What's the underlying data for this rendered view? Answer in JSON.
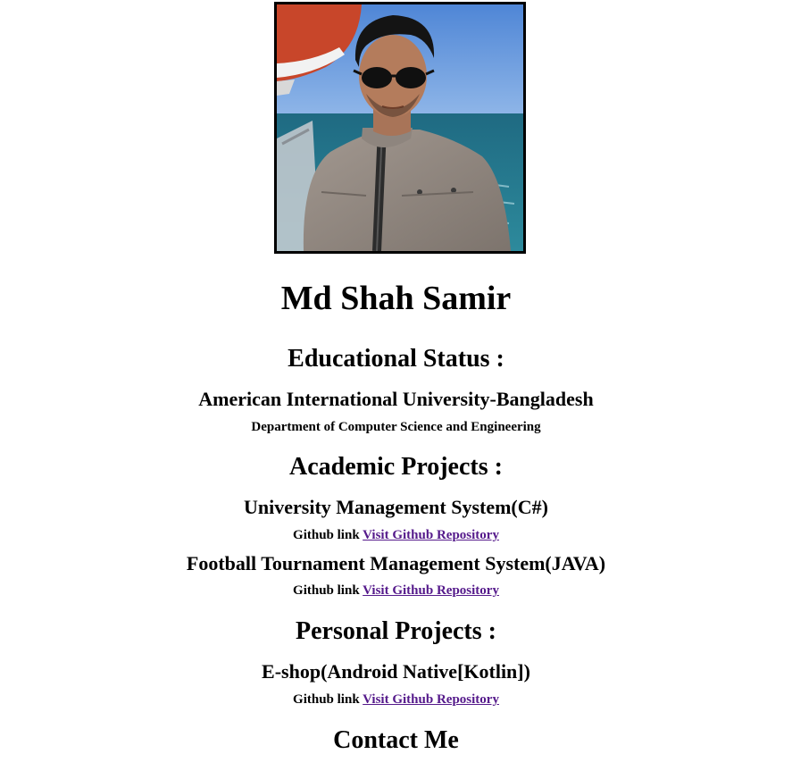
{
  "profile": {
    "photo_alt": "Md Shah Samir",
    "name": "Md Shah Samir"
  },
  "education": {
    "heading": "Educational Status :",
    "university": "American International University-Bangladesh",
    "department": "Department of Computer Science and Engineering"
  },
  "academic": {
    "heading": "Academic Projects :",
    "projects": [
      {
        "title": "University Management System(C#)",
        "link_prefix": "Github link",
        "link_text": "Visit Github Repository"
      },
      {
        "title": "Football Tournament Management System(JAVA)",
        "link_prefix": "Github link",
        "link_text": "Visit Github Repository"
      }
    ]
  },
  "personal": {
    "heading": "Personal Projects :",
    "projects": [
      {
        "title": "E-shop(Android Native[Kotlin])",
        "link_prefix": "Github link",
        "link_text": "Visit Github Repository"
      }
    ]
  },
  "contact": {
    "heading": "Contact Me"
  },
  "colors": {
    "visited_link": "#551a8b",
    "text": "#000000",
    "background": "#ffffff"
  }
}
